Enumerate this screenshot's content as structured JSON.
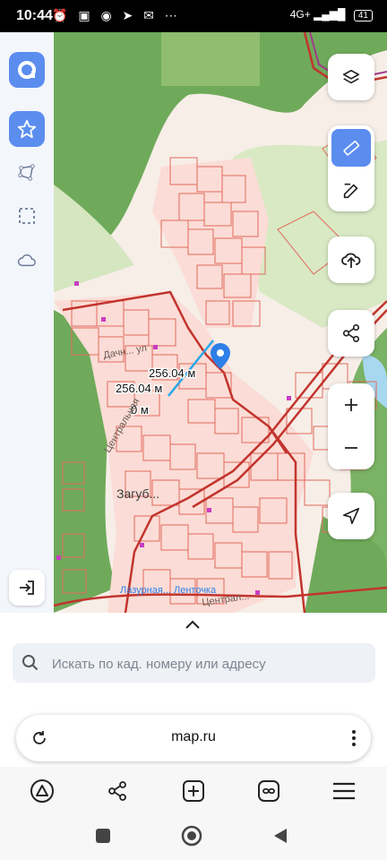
{
  "status_bar": {
    "time": "10:44",
    "network": "4G+",
    "battery": "41"
  },
  "map": {
    "measure_labels": [
      "256.04 м",
      "256.04 м",
      "0 м"
    ],
    "place_labels": [
      "Дачн... ул",
      "Центральная",
      "Загуб...",
      "Лазурная... Ленточка",
      "Централ..."
    ]
  },
  "search": {
    "placeholder": "Искать по кад. номеру или адресу"
  },
  "browser": {
    "url": "map.ru"
  },
  "colors": {
    "accent": "#5b8def",
    "parcel_stroke": "#e06a5c",
    "boundary": "#c2342d",
    "forest": "#6fae5e",
    "meadow": "#d9e9c4"
  },
  "icons": {
    "logo": "app-logo-icon",
    "favorites": "star-icon",
    "polygon": "polygon-tool-icon",
    "select": "select-area-icon",
    "cloud": "cloud-icon",
    "logout": "logout-icon",
    "layers": "layers-icon",
    "ruler": "ruler-icon",
    "edit": "edit-icon",
    "upload": "upload-icon",
    "share": "share-icon",
    "zoom_in": "plus-icon",
    "zoom_out": "minus-icon",
    "locate": "locate-icon"
  }
}
